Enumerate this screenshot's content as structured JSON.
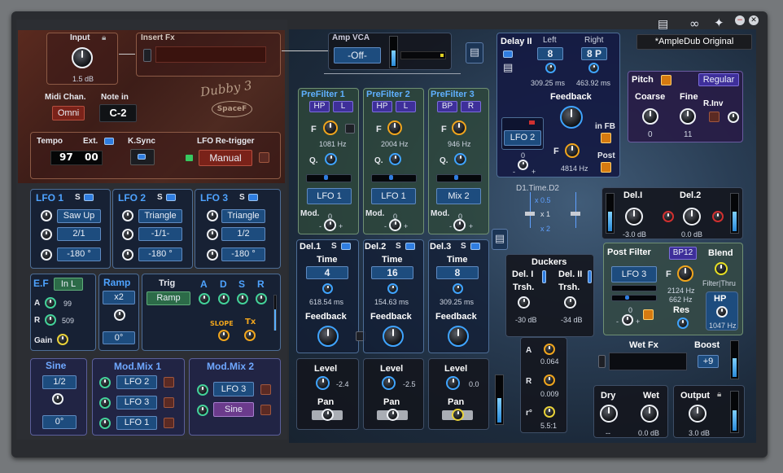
{
  "header": {
    "preset": "*AmpleDub Original"
  },
  "left": {
    "input": {
      "label": "Input",
      "value": "1.5 dB"
    },
    "insert_fx": {
      "label": "Insert Fx"
    },
    "logo": {
      "line1": "Dubby 3",
      "line2": "SpaceF"
    },
    "midi": {
      "chan_label": "Midi Chan.",
      "chan_value": "Omni",
      "note_label": "Note in",
      "note_value": "C-2"
    },
    "tempo": {
      "label": "Tempo",
      "ext_label": "Ext.",
      "value1": "97",
      "value2": "00",
      "ksync_label": "K.Sync",
      "lfo_retrig_label": "LFO Re-trigger",
      "lfo_retrig_value": "Manual"
    },
    "lfo1": {
      "title": "LFO 1",
      "s": "S",
      "shape": "Saw Up",
      "rate": "2/1",
      "phase": "-180 °"
    },
    "lfo2": {
      "title": "LFO 2",
      "s": "S",
      "shape": "Triangle",
      "rate": "-1/1-",
      "phase": "-180 °"
    },
    "lfo3": {
      "title": "LFO 3",
      "s": "S",
      "shape": "Triangle",
      "rate": "1/2",
      "phase": "-180 °"
    },
    "ef": {
      "title": "E.F",
      "input": "In L",
      "a_label": "A",
      "a_value": "99",
      "r_label": "R",
      "r_value": "509",
      "gain_label": "Gain"
    },
    "ramp": {
      "title": "Ramp",
      "mult": "x2",
      "deg": "0°"
    },
    "trig": {
      "title": "Trig",
      "value": "Ramp",
      "a": "A",
      "d": "D",
      "s": "S",
      "r": "R",
      "slope": "SLOPE",
      "tx": "Tx"
    },
    "sine": {
      "title": "Sine",
      "rate": "1/2",
      "deg": "0°"
    },
    "modmix1": {
      "title": "Mod.Mix 1",
      "items": [
        "LFO 2",
        "LFO 3",
        "LFO 1"
      ]
    },
    "modmix2": {
      "title": "Mod.Mix 2",
      "items": [
        "LFO 3",
        "Sine"
      ]
    }
  },
  "right": {
    "ampvca": {
      "label": "Amp VCA",
      "value": "-Off-"
    },
    "prefilter": [
      {
        "title": "PreFilter 1",
        "type": "HP",
        "ch": "L",
        "f": "F",
        "freq": "1081 Hz",
        "q": "Q.",
        "mod_src": "LFO 1",
        "mod_label": "Mod.",
        "mod_min": "-",
        "mod_zero": "0",
        "mod_max": "+"
      },
      {
        "title": "PreFilter 2",
        "type": "HP",
        "ch": "L",
        "f": "F",
        "freq": "2004 Hz",
        "q": "Q.",
        "mod_src": "LFO 1",
        "mod_label": "Mod.",
        "mod_min": "-",
        "mod_zero": "0",
        "mod_max": "+"
      },
      {
        "title": "PreFilter 3",
        "type": "BP",
        "ch": "R",
        "f": "F",
        "freq": "946 Hz",
        "q": "Q.",
        "mod_src": "Mix 2",
        "mod_label": "Mod.",
        "mod_min": "-",
        "mod_zero": "0",
        "mod_max": "+"
      }
    ],
    "delays": [
      {
        "title": "Del.1",
        "s": "S",
        "time_label": "Time",
        "time": "4",
        "ms": "618.54 ms",
        "fb_label": "Feedback",
        "level_label": "Level",
        "level": "-2.4",
        "pan_label": "Pan"
      },
      {
        "title": "Del.2",
        "s": "S",
        "time_label": "Time",
        "time": "16",
        "ms": "154.63 ms",
        "fb_label": "Feedback",
        "level_label": "Level",
        "level": "-2.5",
        "pan_label": "Pan"
      },
      {
        "title": "Del.3",
        "s": "S",
        "time_label": "Time",
        "time": "8",
        "ms": "309.25 ms",
        "fb_label": "Feedback",
        "level_label": "Level",
        "level": "0.0",
        "pan_label": "Pan"
      }
    ],
    "delay2": {
      "title": "Delay II",
      "left_label": "Left",
      "right_label": "Right",
      "left": "8",
      "right": "8 P",
      "left_ms": "309.25 ms",
      "right_ms": "463.92 ms",
      "fb_label": "Feedback",
      "mod_src": "LFO 2",
      "f_label": "F",
      "freq": "4814 Hz",
      "in_fb": "in FB",
      "post": "Post",
      "zero": "0",
      "minus": "-",
      "plus": "+"
    },
    "pitch": {
      "title": "Pitch",
      "mode": "Regular",
      "coarse_label": "Coarse",
      "coarse": "0",
      "fine_label": "Fine",
      "fine": "11",
      "rinv": "R.Inv"
    },
    "d1time": {
      "title": "D1.Time.D2",
      "x05": "x 0.5",
      "x1": "x 1",
      "x2": "x 2"
    },
    "duckers": {
      "title": "Duckers",
      "del1": "Del. I",
      "del2": "Del. II",
      "trsh": "Trsh.",
      "v1": "-30 dB",
      "v2": "-34 dB",
      "a_label": "A",
      "a": "0.064",
      "r_label": "R",
      "r": "0.009",
      "ratio_label": "r°",
      "ratio": "5.5:1"
    },
    "dels": {
      "del1": "Del.I",
      "del2": "Del.2",
      "v1": "-3.0 dB",
      "v2": "0.0 dB"
    },
    "postfilter": {
      "title": "Post Filter",
      "type": "BP12",
      "mod_src": "LFO 3",
      "f_label": "F",
      "freq1": "2124 Hz",
      "freq2": "662 Hz",
      "res": "Res",
      "minus": "-",
      "zero": "0",
      "plus": "+",
      "blend": "Blend",
      "filter_thru": "Filter|Thru",
      "hp": "HP",
      "hp_freq": "1047 Hz"
    },
    "wetfx": {
      "label": "Wet Fx",
      "boost_label": "Boost",
      "boost": "+9"
    },
    "drywet": {
      "dry_label": "Dry",
      "wet_label": "Wet",
      "dry": "--",
      "wet": "0.0 dB"
    },
    "output": {
      "label": "Output",
      "value": "3.0 dB"
    }
  }
}
